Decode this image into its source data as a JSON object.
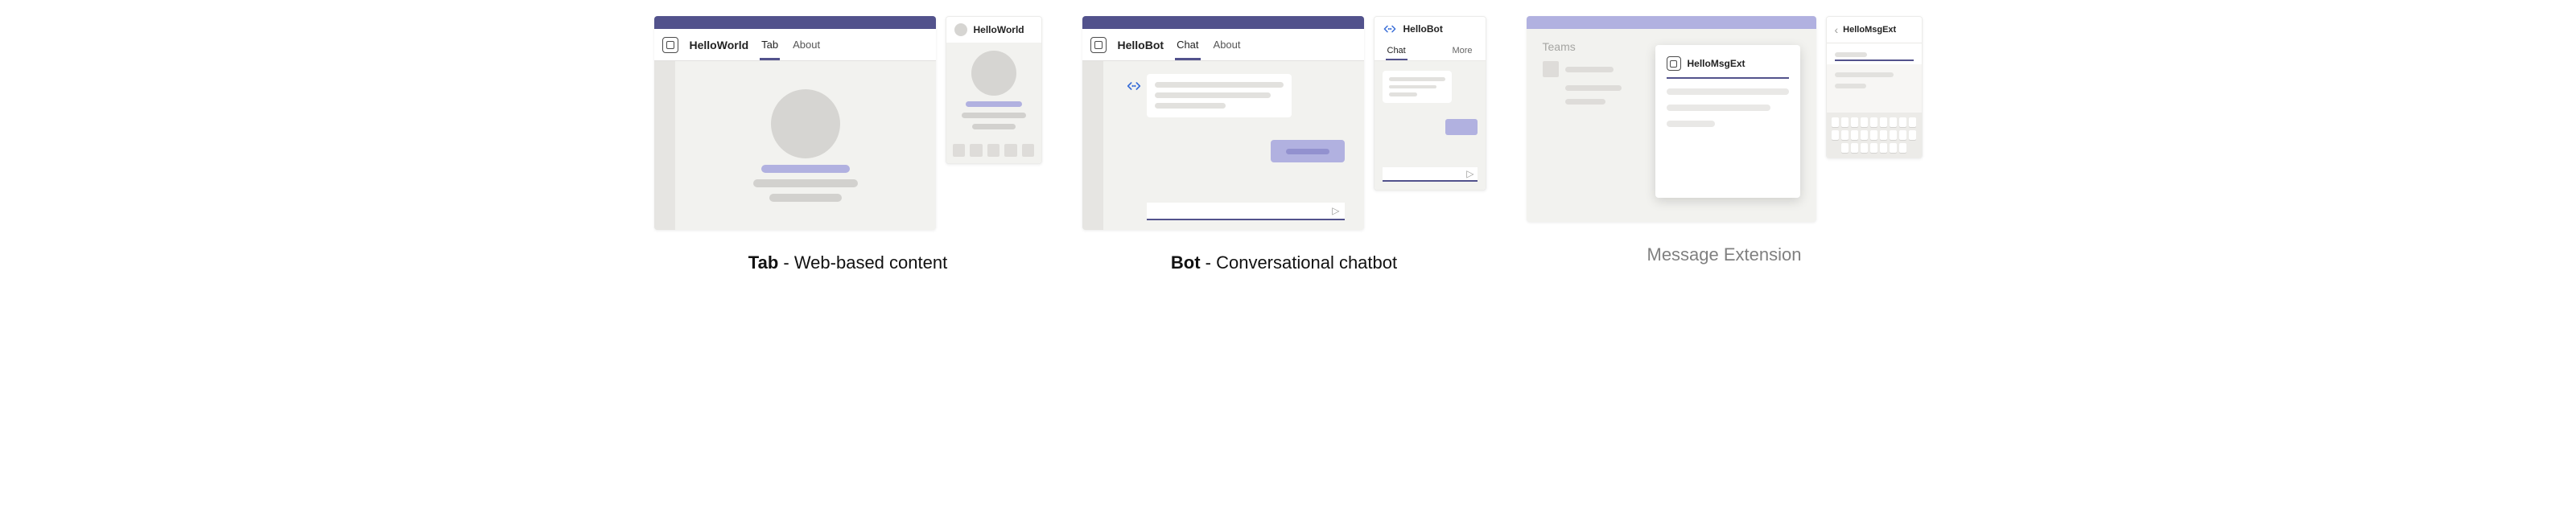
{
  "tab": {
    "desktop": {
      "app_name": "HelloWorld",
      "tabs": {
        "active": "Tab",
        "other": "About"
      }
    },
    "mobile": {
      "title": "HelloWorld"
    },
    "caption_bold": "Tab",
    "caption_rest": " - Web-based content"
  },
  "bot": {
    "desktop": {
      "app_name": "HelloBot",
      "tabs": {
        "active": "Chat",
        "other": "About"
      }
    },
    "mobile": {
      "title": "HelloBot",
      "tabs": {
        "active": "Chat",
        "other": "More"
      }
    },
    "caption_bold": "Bot",
    "caption_rest": " - Conversational chatbot"
  },
  "msgext": {
    "desktop": {
      "sidebar_label": "Teams",
      "card_title": "HelloMsgExt"
    },
    "mobile": {
      "title": "HelloMsgExt"
    },
    "caption": "Message Extension"
  }
}
